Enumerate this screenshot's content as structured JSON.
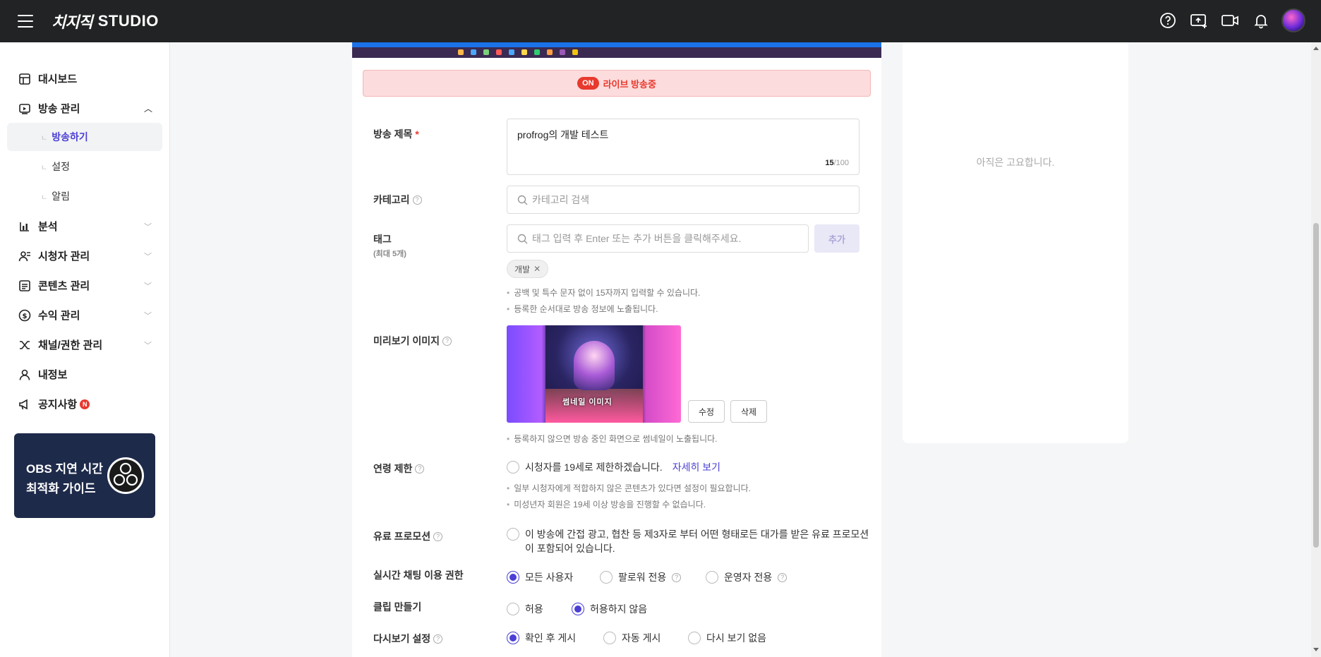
{
  "header": {
    "brand": "치지직",
    "studio": "STUDIO"
  },
  "sidebar": {
    "items": [
      {
        "label": "대시보드"
      },
      {
        "label": "방송 관리"
      },
      {
        "label": "분석"
      },
      {
        "label": "시청자 관리"
      },
      {
        "label": "콘텐츠 관리"
      },
      {
        "label": "수익 관리"
      },
      {
        "label": "채널/권한 관리"
      },
      {
        "label": "내정보"
      },
      {
        "label": "공지사항"
      }
    ],
    "sub_items": [
      {
        "label": "방송하기"
      },
      {
        "label": "설정"
      },
      {
        "label": "알림"
      }
    ],
    "notice_badge": "N",
    "banner": {
      "line1": "OBS 지연 시간",
      "line2": "최적화 가이드"
    }
  },
  "live": {
    "pill": "ON",
    "text": "라이브 방송중"
  },
  "form": {
    "title_label": "방송 제목",
    "required_mark": "*",
    "title_value": "profrog의 개발 테스트",
    "title_count": "15",
    "title_max": "/100",
    "category_label": "카테고리",
    "category_placeholder": "카테고리 검색",
    "tag_label": "태그",
    "tag_sublabel": "(최대 5개)",
    "tag_placeholder": "태그 입력 후 Enter 또는 추가 버튼을 클릭해주세요.",
    "tag_add": "추가",
    "tag_chip": "개발",
    "tag_note1": "공백 및 특수 문자 없이 15자까지 입력할 수 있습니다.",
    "tag_note2": "등록한 순서대로 방송 정보에 노출됩니다.",
    "preview_label": "미리보기 이미지",
    "thumb_caption": "썸네일 이미지",
    "edit_btn": "수정",
    "delete_btn": "삭제",
    "preview_note": "등록하지 않으면 방송 중인 화면으로 썸네일이 노출됩니다.",
    "age_label": "연령 제한",
    "age_option": "시청자를 19세로 제한하겠습니다.",
    "age_link": "자세히 보기",
    "age_note1": "일부 시청자에게 적합하지 않은 콘텐츠가 있다면 설정이 필요합니다.",
    "age_note2": "미성년자 회원은 19세 이상 방송을 진행할 수 없습니다.",
    "promo_label": "유료 프로모션",
    "promo_text1": "이 방송에 간접 광고, 협찬 등 제3자로 부터 어떤 형태로든 대가를 받은 유료 프로모션",
    "promo_text2": "이 포함되어 있습니다.",
    "chat_label": "실시간 채팅 이용 권한",
    "chat_options": [
      "모든 사용자",
      "팔로워 전용",
      "운영자 전용"
    ],
    "clip_label": "클립 만들기",
    "clip_options": [
      "허용",
      "허용하지 않음"
    ],
    "replay_label": "다시보기 설정",
    "replay_options": [
      "확인 후 게시",
      "자동 게시",
      "다시 보기 없음"
    ]
  },
  "right_panel": {
    "empty_text": "아직은 고요합니다."
  },
  "icons": {
    "help": "question-circle-icon",
    "upload": "video-upload-icon",
    "camera": "camera-icon",
    "bell": "bell-icon",
    "search": "search-icon"
  },
  "colors": {
    "accent": "#4b3fd6",
    "live": "#e8392e",
    "topbar": "#222324"
  }
}
